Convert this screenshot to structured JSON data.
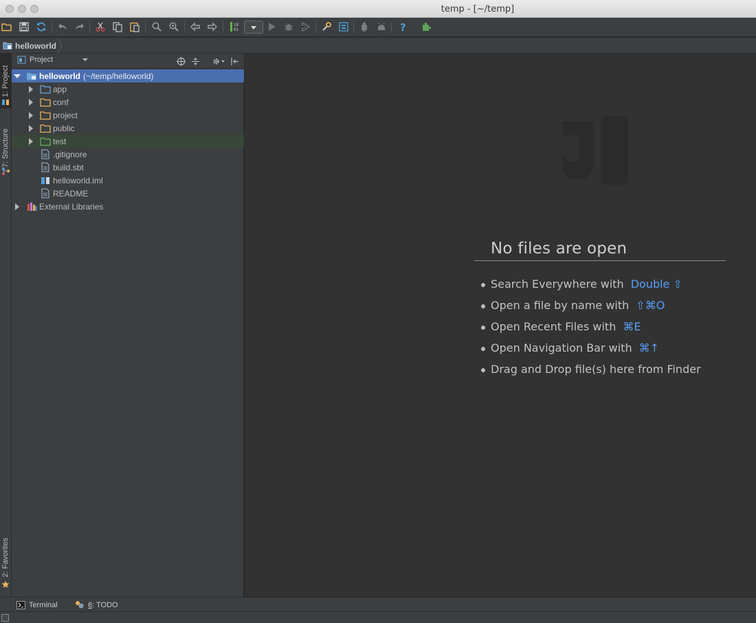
{
  "window": {
    "title": "temp - [~/temp]"
  },
  "breadcrumb": {
    "label": "helloworld"
  },
  "left_stripe": {
    "tabs": [
      {
        "num": "1",
        "label": "1: Project"
      },
      {
        "num": "7",
        "label": "7: Structure"
      },
      {
        "num": "2",
        "label": "2: Favorites"
      }
    ]
  },
  "project_panel": {
    "title": "Project",
    "tree": [
      {
        "label": "helloworld",
        "path": "(~/temp/helloworld)",
        "icon": "module-folder-icon",
        "expanded": true,
        "selected": true
      },
      {
        "label": "app",
        "icon": "folder-icon"
      },
      {
        "label": "conf",
        "icon": "folder-icon"
      },
      {
        "label": "project",
        "icon": "folder-icon"
      },
      {
        "label": "public",
        "icon": "folder-icon"
      },
      {
        "label": "test",
        "icon": "test-folder-icon"
      },
      {
        "label": ".gitignore",
        "icon": "file-icon"
      },
      {
        "label": "build.sbt",
        "icon": "file-icon"
      },
      {
        "label": "helloworld.iml",
        "icon": "iml-file-icon"
      },
      {
        "label": "README",
        "icon": "file-icon"
      },
      {
        "label": "External Libraries",
        "icon": "libraries-icon"
      }
    ]
  },
  "editor": {
    "empty_title": "No files are open",
    "hints": [
      {
        "text": "Search Everywhere with",
        "shortcut": "Double ⇧"
      },
      {
        "text": "Open a file by name with",
        "shortcut": "⇧⌘O"
      },
      {
        "text": "Open Recent Files with",
        "shortcut": "⌘E"
      },
      {
        "text": "Open Navigation Bar with",
        "shortcut": "⌘↑"
      },
      {
        "text": "Drag and Drop file(s) here from Finder",
        "shortcut": ""
      }
    ]
  },
  "bottom_bar": {
    "terminal": "Terminal",
    "todo_num": "6",
    "todo_rest": ": TODO"
  },
  "colors": {
    "selection": "#4b6eaf",
    "shortcut": "#589df6",
    "folder": "#e8b35a",
    "test_folder": "#6ba65b",
    "module_folder": "#6aa6d6"
  }
}
